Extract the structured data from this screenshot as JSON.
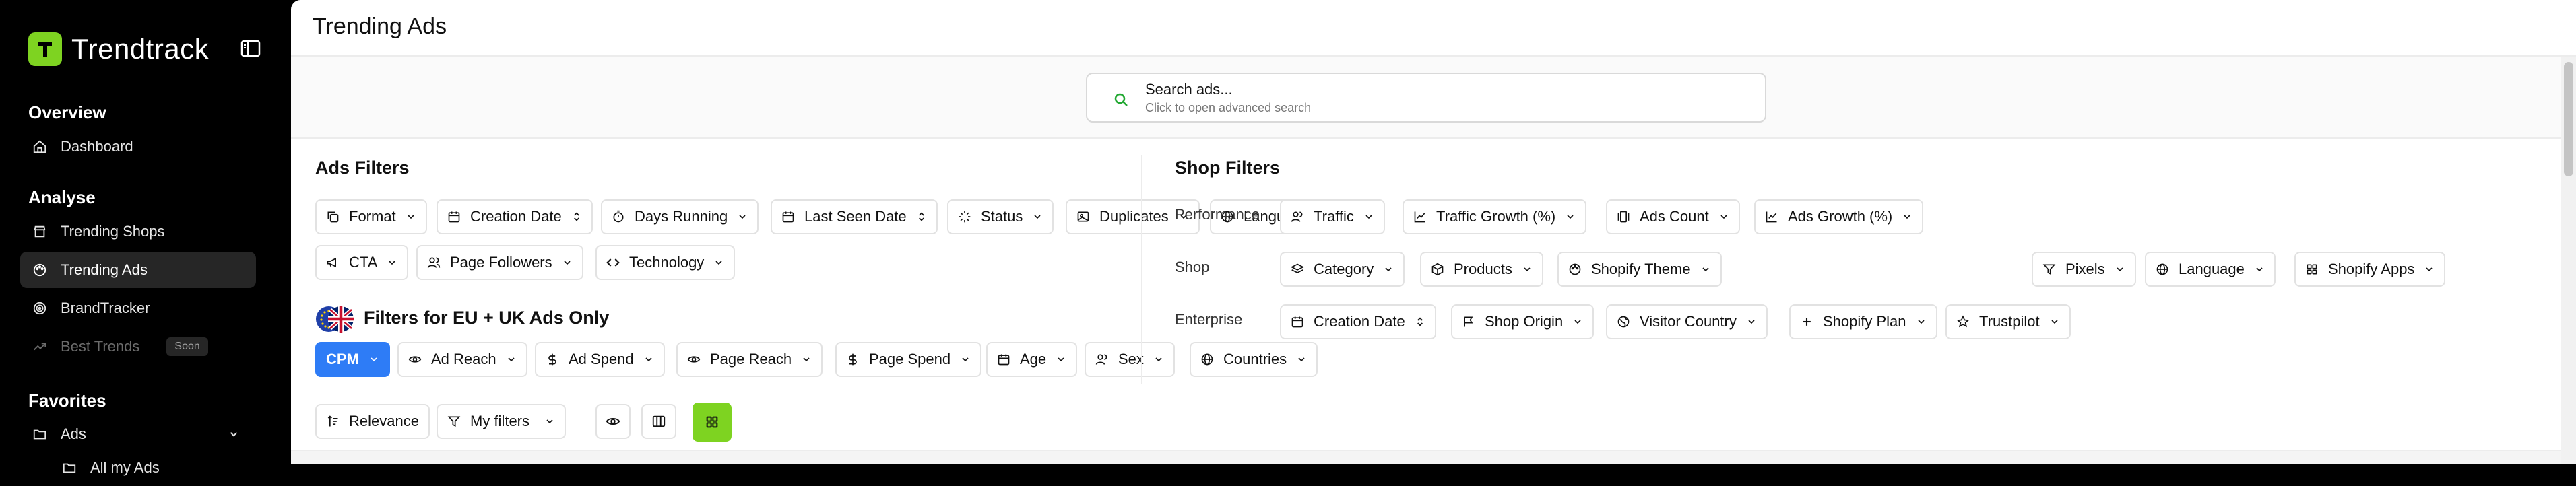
{
  "app": {
    "name": "Trendtrack"
  },
  "sidebar": {
    "sections": [
      {
        "title": "Overview",
        "items": [
          {
            "label": "Dashboard"
          }
        ]
      },
      {
        "title": "Analyse",
        "items": [
          {
            "label": "Trending Shops"
          },
          {
            "label": "Trending Ads",
            "active": true
          },
          {
            "label": "BrandTracker"
          },
          {
            "label": "Best Trends",
            "badge": "Soon",
            "disabled": true
          }
        ]
      },
      {
        "title": "Favorites",
        "items": [
          {
            "label": "Ads"
          },
          {
            "label": "All my Ads"
          }
        ]
      }
    ]
  },
  "header": {
    "title": "Trending Ads"
  },
  "search": {
    "title": "Search ads...",
    "subtitle": "Click to open advanced search"
  },
  "ads_filters": {
    "title": "Ads Filters",
    "row1": [
      "Format",
      "Creation Date",
      "Days Running",
      "Last Seen Date",
      "Status",
      "Duplicates",
      "Language"
    ],
    "row2": [
      "CTA",
      "Page Followers",
      "Technology"
    ]
  },
  "eu_filters": {
    "title": "Filters for EU + UK Ads Only",
    "items": [
      "CPM",
      "Ad Reach",
      "Ad Spend",
      "Page Reach",
      "Page Spend",
      "Age",
      "Sex",
      "Countries"
    ]
  },
  "toolbar": {
    "sort": "Relevance",
    "my_filters": "My filters"
  },
  "shop_filters": {
    "title": "Shop Filters",
    "rows": [
      {
        "label": "Performance",
        "items": [
          "Traffic",
          "Traffic Growth (%)",
          "Ads Count",
          "Ads Growth (%)"
        ]
      },
      {
        "label": "Shop",
        "items": [
          "Category",
          "Products",
          "Shopify Theme",
          "Pixels",
          "Language",
          "Shopify Apps"
        ]
      },
      {
        "label": "Enterprise",
        "items": [
          "Creation Date",
          "Shop Origin",
          "Visitor Country",
          "Shopify Plan",
          "Trustpilot"
        ]
      }
    ]
  },
  "colors": {
    "accent_green": "#7ed321",
    "primary_blue": "#2e7cf6",
    "sidebar_bg": "#000000"
  }
}
